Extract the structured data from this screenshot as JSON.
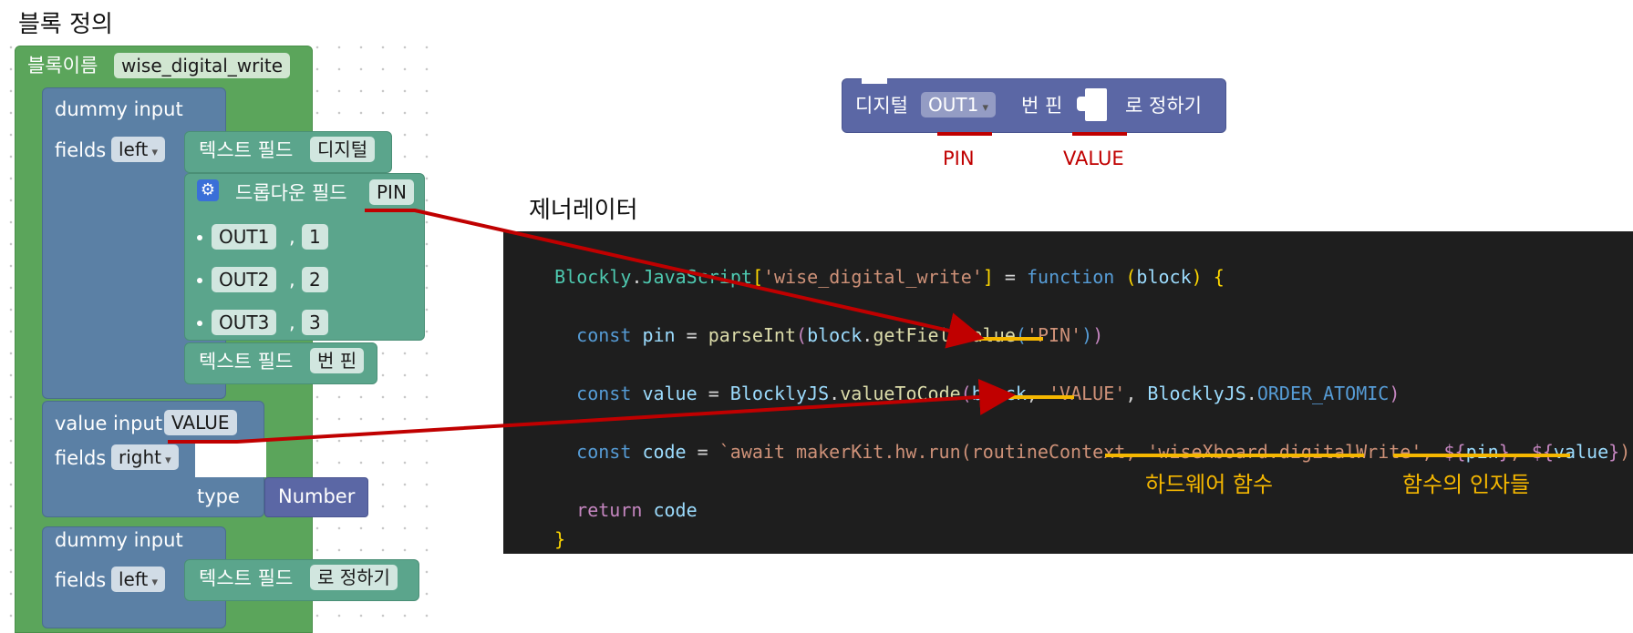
{
  "block_def": {
    "section_title": "블록 정의",
    "name_label": "블록이름",
    "name_value": "wise_digital_write",
    "input1": {
      "type": "dummy input",
      "fields_label": "fields",
      "align": "left"
    },
    "text_field_label": "텍스트 필드",
    "text1": "디지털",
    "dropdown_label": "드롭다운 필드",
    "dropdown_name": "PIN",
    "options": [
      {
        "text": "OUT1",
        "value": "1"
      },
      {
        "text": "OUT2",
        "value": "2"
      },
      {
        "text": "OUT3",
        "value": "3"
      }
    ],
    "option_comma": ",",
    "text2": "번 핀",
    "input2": {
      "type": "value input",
      "name": "VALUE",
      "fields_label": "fields",
      "align": "right",
      "type_label": "type",
      "type_value": "Number"
    },
    "input3": {
      "type": "dummy input",
      "fields_label": "fields",
      "align": "left"
    },
    "text3": "로 정하기"
  },
  "preview": {
    "text_digital": "디지털",
    "pin_value": "OUT1",
    "text_pin": "번 핀",
    "text_set": "로 정하기",
    "pin_label": "PIN",
    "value_label": "VALUE"
  },
  "generator": {
    "title": "제너레이터",
    "line1": [
      "Blockly",
      ".",
      "JavaScript",
      "[",
      "'wise_digital_write'",
      "]",
      " = ",
      "function",
      " (",
      "block",
      ")",
      " {"
    ],
    "line2": [
      "const",
      " ",
      "pin",
      " = ",
      "parseInt",
      "(",
      "block",
      ".",
      "getFieldValue",
      "(",
      "'PIN'",
      ")",
      ")"
    ],
    "line3": [
      "const",
      " ",
      "value",
      " = ",
      "BlocklyJS",
      ".",
      "valueToCode",
      "(",
      "block",
      ", ",
      "'VALUE'",
      ", ",
      "BlocklyJS",
      ".",
      "ORDER_ATOMIC",
      ")"
    ],
    "line4": [
      "const",
      " ",
      "code",
      " = ",
      "`await makerKit.hw.run(routineContext, ",
      "'wiseXboard.digitalWrite'",
      ", ",
      "${",
      "pin",
      "}",
      ", ",
      "${",
      "value",
      "}",
      ");\\n`"
    ],
    "line5": [
      "return",
      " ",
      "code"
    ],
    "line6": [
      "}"
    ],
    "anno_hw": "하드웨어 함수",
    "anno_args": "함수의 인자들"
  },
  "colors": {
    "block_green": "#5ba55b",
    "input_blue": "#5b80a5",
    "field_teal": "#5ba58c",
    "preview_block": "#5b67a5",
    "annotation_red": "#c00000",
    "annotation_yellow": "#f5b700",
    "code_bg": "#1e1e1e"
  },
  "icons": {
    "settings": "gear-icon",
    "value_slot": "puzzle-slot-icon"
  }
}
